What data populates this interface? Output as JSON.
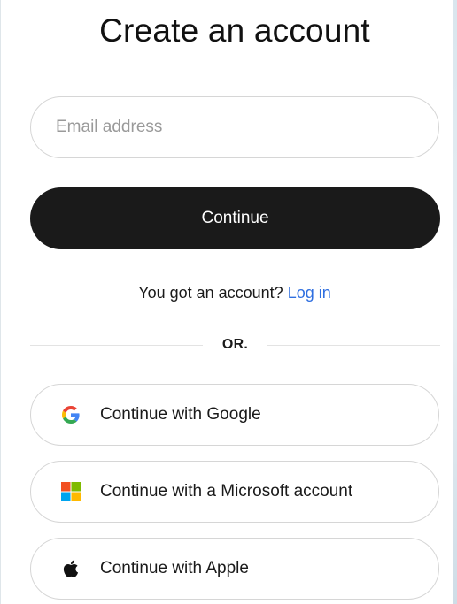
{
  "title": "Create an account",
  "email": {
    "placeholder": "Email address",
    "value": ""
  },
  "continue_label": "Continue",
  "login_prompt": {
    "text": "You got an account?",
    "link": "Log in"
  },
  "divider": "OR.",
  "social": [
    {
      "label": "Continue with Google",
      "icon": "google-icon"
    },
    {
      "label": "Continue with a Microsoft account",
      "icon": "microsoft-icon"
    },
    {
      "label": "Continue with Apple",
      "icon": "apple-icon"
    }
  ],
  "colors": {
    "primary_button": "#1a1a1a",
    "link": "#2f6fe0",
    "border": "#d6d6d6"
  }
}
